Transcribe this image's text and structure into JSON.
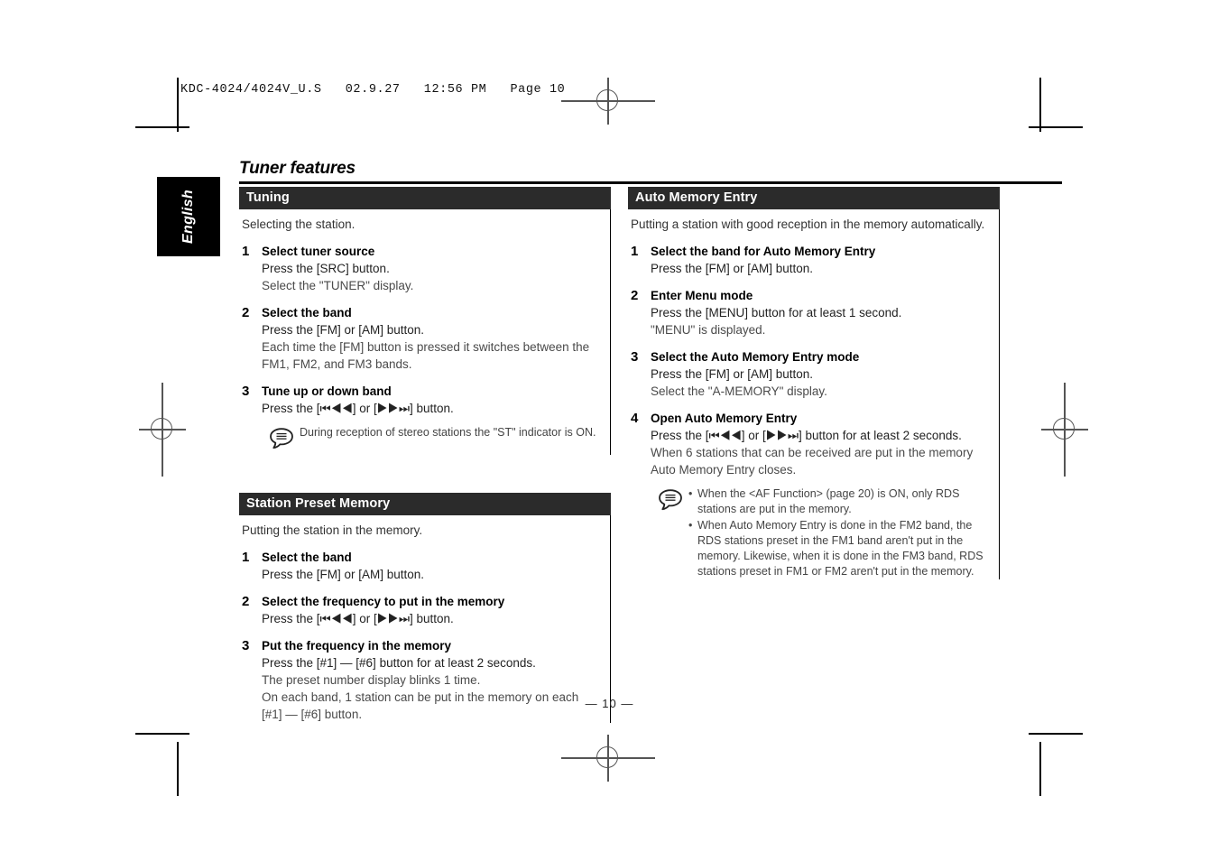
{
  "prepress": {
    "header_line": "KDC-4024/4024V_U.S   02.9.27   12:56 PM   Page 10"
  },
  "language_tab": {
    "label": "English"
  },
  "page": {
    "title": "Tuner features",
    "folio": "— 10 —"
  },
  "icons": {
    "note_bubble": "note-bubble-icon"
  },
  "sections": [
    {
      "id": "tuning",
      "heading": "Tuning",
      "intro": [
        "Selecting the station."
      ],
      "steps": [
        {
          "number": "1",
          "head": "Select tuner source",
          "lines": [
            {
              "text": "Press the [SRC] button.",
              "dim": false
            },
            {
              "text": "Select the \"TUNER\" display.",
              "dim": true
            }
          ]
        },
        {
          "number": "2",
          "head": "Select the band",
          "lines": [
            {
              "text": "Press the [FM] or [AM] button.",
              "dim": false
            },
            {
              "text": "Each time the [FM] button is pressed it switches between the FM1, FM2, and FM3 bands.",
              "dim": true
            }
          ]
        },
        {
          "number": "3",
          "head": "Tune up or down band",
          "lines": [
            {
              "text": "Press the [⏮◀◀] or [▶▶⏭] button.",
              "dim": false
            }
          ],
          "note": {
            "text": "During reception of stereo stations the \"ST\" indicator is ON.",
            "bullets": []
          }
        }
      ]
    },
    {
      "id": "station-preset-memory",
      "heading": "Station Preset Memory",
      "intro": [
        "Putting the station in the memory."
      ],
      "steps": [
        {
          "number": "1",
          "head": "Select the band",
          "lines": [
            {
              "text": "Press the [FM] or [AM] button.",
              "dim": false
            }
          ]
        },
        {
          "number": "2",
          "head": "Select the frequency to put in the memory",
          "lines": [
            {
              "text": "Press the [⏮◀◀] or [▶▶⏭] button.",
              "dim": false
            }
          ]
        },
        {
          "number": "3",
          "head": "Put the frequency in the memory",
          "lines": [
            {
              "text": "Press the [#1] — [#6] button for at least 2 seconds.",
              "dim": false
            },
            {
              "text": "The preset number display blinks 1 time.",
              "dim": true
            },
            {
              "text": "On each band, 1 station can be put in the memory on each [#1] — [#6] button.",
              "dim": true
            }
          ]
        }
      ]
    },
    {
      "id": "auto-memory-entry",
      "heading": "Auto Memory Entry",
      "intro": [
        "Putting a station with good reception in the memory automatically."
      ],
      "steps": [
        {
          "number": "1",
          "head": "Select the band for Auto Memory Entry",
          "lines": [
            {
              "text": "Press the [FM] or [AM] button.",
              "dim": false
            }
          ]
        },
        {
          "number": "2",
          "head": "Enter Menu mode",
          "lines": [
            {
              "text": "Press the [MENU] button for at least 1 second.",
              "dim": false
            },
            {
              "text": "\"MENU\" is displayed.",
              "dim": true
            }
          ]
        },
        {
          "number": "3",
          "head": "Select the Auto Memory Entry mode",
          "lines": [
            {
              "text": "Press the [FM] or [AM] button.",
              "dim": false
            },
            {
              "text": "Select the \"A-MEMORY\" display.",
              "dim": true
            }
          ]
        },
        {
          "number": "4",
          "head": "Open Auto Memory Entry",
          "lines": [
            {
              "text": "Press the [⏮◀◀] or [▶▶⏭] button for at least 2 seconds.",
              "dim": false
            },
            {
              "text": "When 6 stations that can be received are put in the memory Auto Memory Entry closes.",
              "dim": true
            }
          ],
          "note": {
            "text": "",
            "bullets": [
              "When the <AF Function> (page 20) is ON, only RDS stations are put in the memory.",
              "When Auto Memory Entry is done in the FM2 band, the RDS stations preset in the FM1 band aren't put in the memory. Likewise, when it is done in the FM3 band, RDS stations preset in FM1 or FM2 aren't put in the memory."
            ]
          }
        }
      ]
    }
  ]
}
